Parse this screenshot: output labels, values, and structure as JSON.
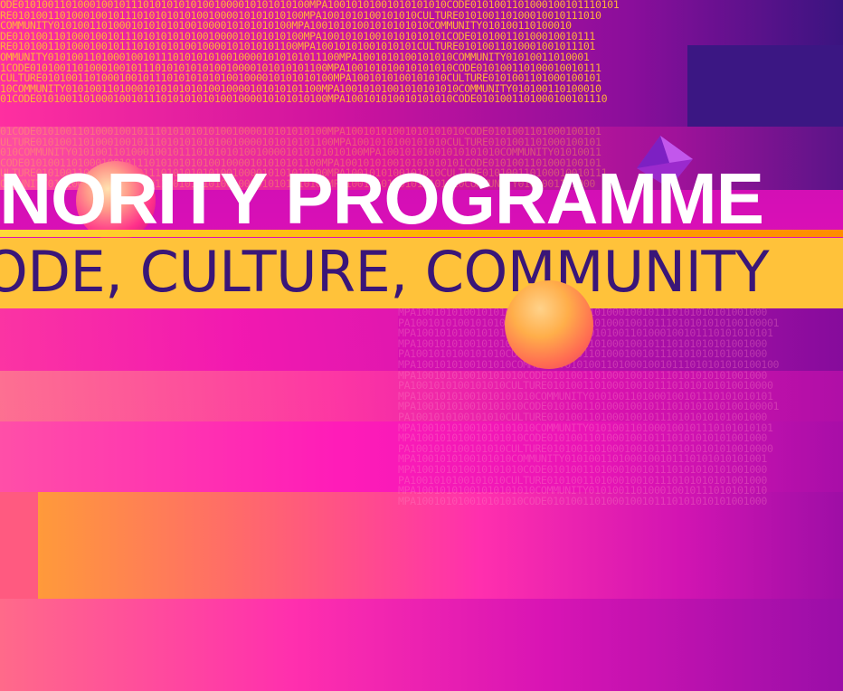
{
  "banner": {
    "title": "INORITY PROGRAMME",
    "subtitle": "ODE, CULTURE, COMMUNITY"
  },
  "binary": {
    "top_rows": [
      "ODE0101001101000100101110101010101001000010101010100MPA10010101001010101010CODE0101001101000100101110101",
      "RE0101001101000100101110101010101001000010101010100MPA1001010100101010CULTURE010100110100010010111010",
      "COMMUNITY0101001101000101010101001000010101010100MPA10010101001010101010COMMUNITY010100110100010",
      "DE0101001101000100101110101010101001000010101010100MPA100101010010101010101CODE010100110100010010111",
      "RE010100110100010010111010101010010000101010101100MPA10010101001010101CULTURE01010011010001001011101",
      "OMMUNITY0101001101000100101110101010100100001010101011100MPA1001010100101010COMMUNITY01010011010001",
      "1CODE01010011010001001011101010101010010000101010101100MPA100101010010101010CODE010100110100010010111",
      "CULTURE0101001101000100101110101010101001000010101010100MPA1001010100101010CULTURE0101001101000100101",
      "10COMMUNITY0101001101000101010101010010000101010101100MPA10010101001010101010COMMUNITY010100110100010",
      "01CODE0101001101000100101110101010101001000010101010100MPA100101010010101010CODE0101001101000100101110"
    ],
    "faint_rows": [
      "01CODE0101001101000100101110101010101001000010101010100MPA10010101001010101010CODE0101001101000100101",
      "ULTURE01010011010001001011101010101010010000101010101100MPA1001010100101010CULTURE0101001101000100101",
      "010COMMUNITY0101001101000100101110101010100100001010101010100MPA10010101001010101010COMMUNITY01010011",
      "CODE01010011010001001011101010101010010000101010101100MPA100101010010101010101CODE0101001101000100101",
      "ULTURE0101001101000100101110101010101001000010101010100MPA1001010100101010CULTURE010100110100010010111",
      "OMMUNITY01010011010001001011101010101001000010101010100MPA10010101001010101010COMMUNITY0101001101000"
    ],
    "right_rows": [
      "MPA100101010010101010CODE0101001101000100101110101010101001000",
      "PA1001010100101010CULTURE010100110100010010111010101010100100001",
      "MPA10010101001010101010COMMUNITY0101001101000100101110101010101",
      "MPA100101010010101010CODE0101001101000100101110101010101001000",
      "PA1001010100101010CULTURE0101001101000100101110101010101001000",
      "MPA1001010100101010COMMUNITY010100110100010010111010101010100100",
      "MPA100101010010101010CODE0101001101000100101110101010101001000",
      "PA1001010100101010CULTURE01010011010001001011101010101010010000",
      "MPA10010101001010101010COMMUNITY0101001101000100101110101010101",
      "MPA100101010010101010CODE010100110100010010111010101010100100001",
      "PA1001010100101010CULTURE0101001101000100101110101010101001000",
      "MPA10010101001010101010COMMUNITY0101001101000100101110101010101",
      "MPA100101010010101010CODE0101001101000100101110101010101001000",
      "PA1001010100101010CULTURE01010011010001001011101010101010010000",
      "MPA1001010100101010COMMUNITY0101001101000100101110101010101001",
      "MPA100101010010101010CODE0101001101000100101110101010101001000",
      "PA1001010100101010CULTURE0101001101000100101110101010101001000",
      "MPA10010101001010101010COMMUNITY010100110100010010111010101010",
      "MPA100101010010101010CODE0101001101000100101110101010101001000"
    ]
  },
  "colors": {
    "title": "#ffffff",
    "subtitle": "#3a1678",
    "yellow_bar": "#ffc23a",
    "binary_orange": "#ffb13a"
  }
}
